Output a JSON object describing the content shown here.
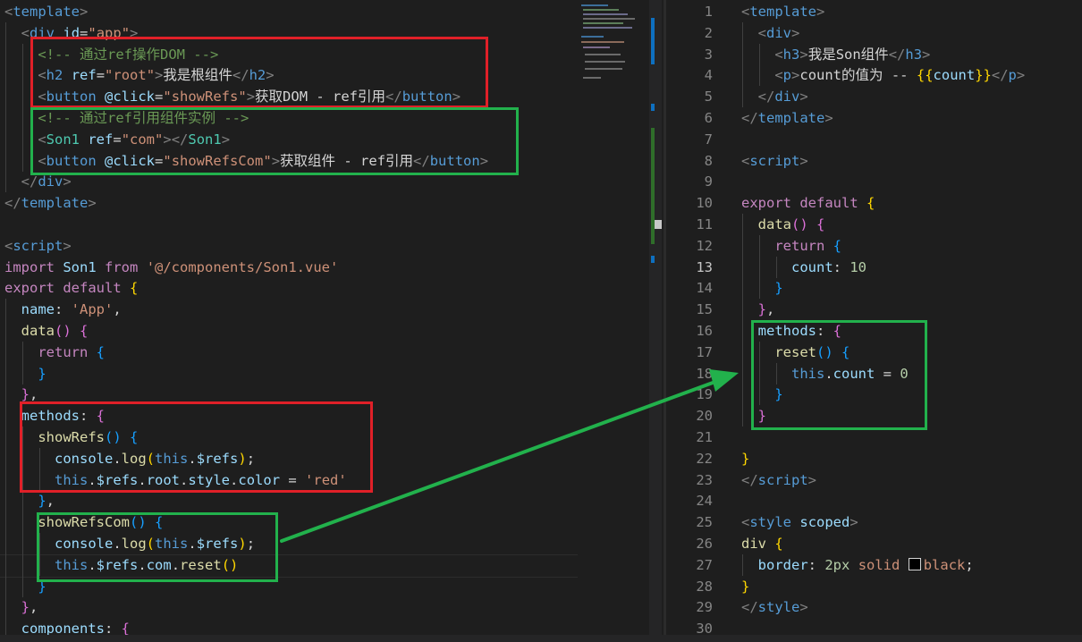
{
  "left_editor": {
    "lines": [
      [
        [
          "t-br",
          "<"
        ],
        [
          "t-tag",
          "template"
        ],
        [
          "t-br",
          ">"
        ]
      ],
      [
        [
          "t-txt",
          "  "
        ],
        [
          "t-br",
          "<"
        ],
        [
          "t-tag",
          "div"
        ],
        [
          "t-txt",
          " "
        ],
        [
          "t-attr",
          "id"
        ],
        [
          "t-txt",
          "="
        ],
        [
          "t-str",
          "\"app\""
        ],
        [
          "t-br",
          ">"
        ]
      ],
      [
        [
          "t-txt",
          "    "
        ],
        [
          "t-cmt",
          "<!-- 通过ref操作DOM -->"
        ]
      ],
      [
        [
          "t-txt",
          "    "
        ],
        [
          "t-br",
          "<"
        ],
        [
          "t-tag",
          "h2"
        ],
        [
          "t-txt",
          " "
        ],
        [
          "t-attr",
          "ref"
        ],
        [
          "t-txt",
          "="
        ],
        [
          "t-str",
          "\"root\""
        ],
        [
          "t-br",
          ">"
        ],
        [
          "t-txt",
          "我是根组件"
        ],
        [
          "t-br",
          "</"
        ],
        [
          "t-tag",
          "h2"
        ],
        [
          "t-br",
          ">"
        ]
      ],
      [
        [
          "t-txt",
          "    "
        ],
        [
          "t-br",
          "<"
        ],
        [
          "t-tag",
          "button"
        ],
        [
          "t-txt",
          " "
        ],
        [
          "t-attr",
          "@click"
        ],
        [
          "t-txt",
          "="
        ],
        [
          "t-str",
          "\"showRefs\""
        ],
        [
          "t-br",
          ">"
        ],
        [
          "t-txt",
          "获取DOM - ref引用"
        ],
        [
          "t-br",
          "</"
        ],
        [
          "t-tag",
          "button"
        ],
        [
          "t-br",
          ">"
        ]
      ],
      [
        [
          "t-txt",
          "    "
        ],
        [
          "t-cmt",
          "<!-- 通过ref引用组件实例 -->"
        ]
      ],
      [
        [
          "t-txt",
          "    "
        ],
        [
          "t-br",
          "<"
        ],
        [
          "t-cls",
          "Son1"
        ],
        [
          "t-txt",
          " "
        ],
        [
          "t-attr",
          "ref"
        ],
        [
          "t-txt",
          "="
        ],
        [
          "t-str",
          "\"com\""
        ],
        [
          "t-br",
          "></"
        ],
        [
          "t-cls",
          "Son1"
        ],
        [
          "t-br",
          ">"
        ]
      ],
      [
        [
          "t-txt",
          "    "
        ],
        [
          "t-br",
          "<"
        ],
        [
          "t-tag",
          "button"
        ],
        [
          "t-txt",
          " "
        ],
        [
          "t-attr",
          "@click"
        ],
        [
          "t-txt",
          "="
        ],
        [
          "t-str",
          "\"showRefsCom\""
        ],
        [
          "t-br",
          ">"
        ],
        [
          "t-txt",
          "获取组件 - ref引用"
        ],
        [
          "t-br",
          "</"
        ],
        [
          "t-tag",
          "button"
        ],
        [
          "t-br",
          ">"
        ]
      ],
      [
        [
          "t-txt",
          "  "
        ],
        [
          "t-br",
          "</"
        ],
        [
          "t-tag",
          "div"
        ],
        [
          "t-br",
          ">"
        ]
      ],
      [
        [
          "t-br",
          "</"
        ],
        [
          "t-tag",
          "template"
        ],
        [
          "t-br",
          ">"
        ]
      ],
      [],
      [
        [
          "t-br",
          "<"
        ],
        [
          "t-tag",
          "script"
        ],
        [
          "t-br",
          ">"
        ]
      ],
      [
        [
          "t-kw",
          "import"
        ],
        [
          "t-txt",
          " "
        ],
        [
          "t-prop",
          "Son1"
        ],
        [
          "t-txt",
          " "
        ],
        [
          "t-kw",
          "from"
        ],
        [
          "t-txt",
          " "
        ],
        [
          "t-str",
          "'@/components/Son1.vue'"
        ]
      ],
      [
        [
          "t-kw",
          "export"
        ],
        [
          "t-txt",
          " "
        ],
        [
          "t-kw",
          "default"
        ],
        [
          "t-txt",
          " "
        ],
        [
          "t-p1",
          "{"
        ]
      ],
      [
        [
          "t-txt",
          "  "
        ],
        [
          "t-prop",
          "name"
        ],
        [
          "t-txt",
          ": "
        ],
        [
          "t-str",
          "'App'"
        ],
        [
          "t-txt",
          ","
        ]
      ],
      [
        [
          "t-txt",
          "  "
        ],
        [
          "t-fn",
          "data"
        ],
        [
          "t-p2",
          "()"
        ],
        [
          "t-txt",
          " "
        ],
        [
          "t-p2",
          "{"
        ]
      ],
      [
        [
          "t-txt",
          "    "
        ],
        [
          "t-kw",
          "return"
        ],
        [
          "t-txt",
          " "
        ],
        [
          "t-p3",
          "{"
        ]
      ],
      [
        [
          "t-txt",
          "    "
        ],
        [
          "t-p3",
          "}"
        ]
      ],
      [
        [
          "t-txt",
          "  "
        ],
        [
          "t-p2",
          "}"
        ],
        [
          "t-txt",
          ","
        ]
      ],
      [
        [
          "t-txt",
          "  "
        ],
        [
          "t-prop",
          "methods"
        ],
        [
          "t-txt",
          ": "
        ],
        [
          "t-p2",
          "{"
        ]
      ],
      [
        [
          "t-txt",
          "    "
        ],
        [
          "t-fn",
          "showRefs"
        ],
        [
          "t-p3",
          "()"
        ],
        [
          "t-txt",
          " "
        ],
        [
          "t-p3",
          "{"
        ]
      ],
      [
        [
          "t-txt",
          "      "
        ],
        [
          "t-prop",
          "console"
        ],
        [
          "t-txt",
          "."
        ],
        [
          "t-fn",
          "log"
        ],
        [
          "t-p1",
          "("
        ],
        [
          "t-this",
          "this"
        ],
        [
          "t-txt",
          "."
        ],
        [
          "t-prop",
          "$refs"
        ],
        [
          "t-p1",
          ")"
        ],
        [
          "t-txt",
          ";"
        ]
      ],
      [
        [
          "t-txt",
          "      "
        ],
        [
          "t-this",
          "this"
        ],
        [
          "t-txt",
          "."
        ],
        [
          "t-prop",
          "$refs"
        ],
        [
          "t-txt",
          "."
        ],
        [
          "t-prop",
          "root"
        ],
        [
          "t-txt",
          "."
        ],
        [
          "t-prop",
          "style"
        ],
        [
          "t-txt",
          "."
        ],
        [
          "t-prop",
          "color"
        ],
        [
          "t-txt",
          " = "
        ],
        [
          "t-str",
          "'red'"
        ]
      ],
      [
        [
          "t-txt",
          "    "
        ],
        [
          "t-p3",
          "}"
        ],
        [
          "t-txt",
          ","
        ]
      ],
      [
        [
          "t-txt",
          "    "
        ],
        [
          "t-fn",
          "showRefsCom"
        ],
        [
          "t-p3",
          "()"
        ],
        [
          "t-txt",
          " "
        ],
        [
          "t-p3",
          "{"
        ]
      ],
      [
        [
          "t-txt",
          "      "
        ],
        [
          "t-prop",
          "console"
        ],
        [
          "t-txt",
          "."
        ],
        [
          "t-fn",
          "log"
        ],
        [
          "t-p1",
          "("
        ],
        [
          "t-this",
          "this"
        ],
        [
          "t-txt",
          "."
        ],
        [
          "t-prop",
          "$refs"
        ],
        [
          "t-p1",
          ")"
        ],
        [
          "t-txt",
          ";"
        ]
      ],
      [
        [
          "t-txt",
          "      "
        ],
        [
          "t-this",
          "this"
        ],
        [
          "t-txt",
          "."
        ],
        [
          "t-prop",
          "$refs"
        ],
        [
          "t-txt",
          "."
        ],
        [
          "t-prop",
          "com"
        ],
        [
          "t-txt",
          "."
        ],
        [
          "t-fn",
          "reset"
        ],
        [
          "t-p1",
          "()"
        ]
      ],
      [
        [
          "t-txt",
          "    "
        ],
        [
          "t-p3",
          "}"
        ]
      ],
      [
        [
          "t-txt",
          "  "
        ],
        [
          "t-p2",
          "}"
        ],
        [
          "t-txt",
          ","
        ]
      ],
      [
        [
          "t-txt",
          "  "
        ],
        [
          "t-prop",
          "components"
        ],
        [
          "t-txt",
          ": "
        ],
        [
          "t-p2",
          "{"
        ]
      ]
    ]
  },
  "right_editor": {
    "active_line": 13,
    "lines": [
      {
        "n": "1",
        "tokens": [
          [
            "t-br",
            "<"
          ],
          [
            "t-tag",
            "template"
          ],
          [
            "t-br",
            ">"
          ]
        ]
      },
      {
        "n": "2",
        "tokens": [
          [
            "t-txt",
            "  "
          ],
          [
            "t-br",
            "<"
          ],
          [
            "t-tag",
            "div"
          ],
          [
            "t-br",
            ">"
          ]
        ]
      },
      {
        "n": "3",
        "tokens": [
          [
            "t-txt",
            "    "
          ],
          [
            "t-br",
            "<"
          ],
          [
            "t-tag",
            "h3"
          ],
          [
            "t-br",
            ">"
          ],
          [
            "t-txt",
            "我是Son组件"
          ],
          [
            "t-br",
            "</"
          ],
          [
            "t-tag",
            "h3"
          ],
          [
            "t-br",
            ">"
          ]
        ]
      },
      {
        "n": "4",
        "tokens": [
          [
            "t-txt",
            "    "
          ],
          [
            "t-br",
            "<"
          ],
          [
            "t-tag",
            "p"
          ],
          [
            "t-br",
            ">"
          ],
          [
            "t-txt",
            "count的值为 -- "
          ],
          [
            "t-p1",
            "{{"
          ],
          [
            "t-prop",
            "count"
          ],
          [
            "t-p1",
            "}}"
          ],
          [
            "t-br",
            "</"
          ],
          [
            "t-tag",
            "p"
          ],
          [
            "t-br",
            ">"
          ]
        ]
      },
      {
        "n": "5",
        "tokens": [
          [
            "t-txt",
            "  "
          ],
          [
            "t-br",
            "</"
          ],
          [
            "t-tag",
            "div"
          ],
          [
            "t-br",
            ">"
          ]
        ]
      },
      {
        "n": "6",
        "tokens": [
          [
            "t-br",
            "</"
          ],
          [
            "t-tag",
            "template"
          ],
          [
            "t-br",
            ">"
          ]
        ]
      },
      {
        "n": "7",
        "tokens": []
      },
      {
        "n": "8",
        "tokens": [
          [
            "t-br",
            "<"
          ],
          [
            "t-tag",
            "script"
          ],
          [
            "t-br",
            ">"
          ]
        ]
      },
      {
        "n": "9",
        "tokens": []
      },
      {
        "n": "10",
        "tokens": [
          [
            "t-kw",
            "export"
          ],
          [
            "t-txt",
            " "
          ],
          [
            "t-kw",
            "default"
          ],
          [
            "t-txt",
            " "
          ],
          [
            "t-p1",
            "{"
          ]
        ]
      },
      {
        "n": "11",
        "tokens": [
          [
            "t-txt",
            "  "
          ],
          [
            "t-fn",
            "data"
          ],
          [
            "t-p2",
            "()"
          ],
          [
            "t-txt",
            " "
          ],
          [
            "t-p2",
            "{"
          ]
        ]
      },
      {
        "n": "12",
        "tokens": [
          [
            "t-txt",
            "    "
          ],
          [
            "t-kw",
            "return"
          ],
          [
            "t-txt",
            " "
          ],
          [
            "t-p3",
            "{"
          ]
        ]
      },
      {
        "n": "13",
        "tokens": [
          [
            "t-txt",
            "      "
          ],
          [
            "t-prop",
            "count"
          ],
          [
            "t-txt",
            ": "
          ],
          [
            "t-num",
            "10"
          ]
        ]
      },
      {
        "n": "14",
        "tokens": [
          [
            "t-txt",
            "    "
          ],
          [
            "t-p3",
            "}"
          ]
        ]
      },
      {
        "n": "15",
        "tokens": [
          [
            "t-txt",
            "  "
          ],
          [
            "t-p2",
            "}"
          ],
          [
            "t-txt",
            ","
          ]
        ]
      },
      {
        "n": "16",
        "tokens": [
          [
            "t-txt",
            "  "
          ],
          [
            "t-prop",
            "methods"
          ],
          [
            "t-txt",
            ": "
          ],
          [
            "t-p2",
            "{"
          ]
        ]
      },
      {
        "n": "17",
        "tokens": [
          [
            "t-txt",
            "    "
          ],
          [
            "t-fn",
            "reset"
          ],
          [
            "t-p3",
            "()"
          ],
          [
            "t-txt",
            " "
          ],
          [
            "t-p3",
            "{"
          ]
        ]
      },
      {
        "n": "18",
        "tokens": [
          [
            "t-txt",
            "      "
          ],
          [
            "t-this",
            "this"
          ],
          [
            "t-txt",
            "."
          ],
          [
            "t-prop",
            "count"
          ],
          [
            "t-txt",
            " = "
          ],
          [
            "t-num",
            "0"
          ]
        ]
      },
      {
        "n": "19",
        "tokens": [
          [
            "t-txt",
            "    "
          ],
          [
            "t-p3",
            "}"
          ]
        ]
      },
      {
        "n": "20",
        "tokens": [
          [
            "t-txt",
            "  "
          ],
          [
            "t-p2",
            "}"
          ]
        ]
      },
      {
        "n": "21",
        "tokens": []
      },
      {
        "n": "22",
        "tokens": [
          [
            "t-p1",
            "}"
          ]
        ]
      },
      {
        "n": "23",
        "tokens": [
          [
            "t-br",
            "</"
          ],
          [
            "t-tag",
            "script"
          ],
          [
            "t-br",
            ">"
          ]
        ]
      },
      {
        "n": "24",
        "tokens": []
      },
      {
        "n": "25",
        "tokens": [
          [
            "t-br",
            "<"
          ],
          [
            "t-tag",
            "style"
          ],
          [
            "t-txt",
            " "
          ],
          [
            "t-attr",
            "scoped"
          ],
          [
            "t-br",
            ">"
          ]
        ]
      },
      {
        "n": "26",
        "tokens": [
          [
            "t-mtd",
            "div"
          ],
          [
            "t-txt",
            " "
          ],
          [
            "t-p1",
            "{"
          ]
        ]
      },
      {
        "n": "27",
        "tokens": [
          [
            "t-txt",
            "  "
          ],
          [
            "t-prop",
            "border"
          ],
          [
            "t-txt",
            ": "
          ],
          [
            "t-num",
            "2px"
          ],
          [
            "t-txt",
            " "
          ],
          [
            "t-str",
            "solid"
          ],
          [
            "t-txt",
            " "
          ],
          [
            "swatch",
            "#000000"
          ],
          [
            "t-str",
            "black"
          ],
          [
            "t-txt",
            ";"
          ]
        ]
      },
      {
        "n": "28",
        "tokens": [
          [
            "t-p1",
            "}"
          ]
        ]
      },
      {
        "n": "29",
        "tokens": [
          [
            "t-br",
            "</"
          ],
          [
            "t-tag",
            "style"
          ],
          [
            "t-br",
            ">"
          ]
        ]
      },
      {
        "n": "30",
        "tokens": []
      }
    ]
  },
  "annotations": {
    "red": "#e02028",
    "green": "#22b14c"
  }
}
